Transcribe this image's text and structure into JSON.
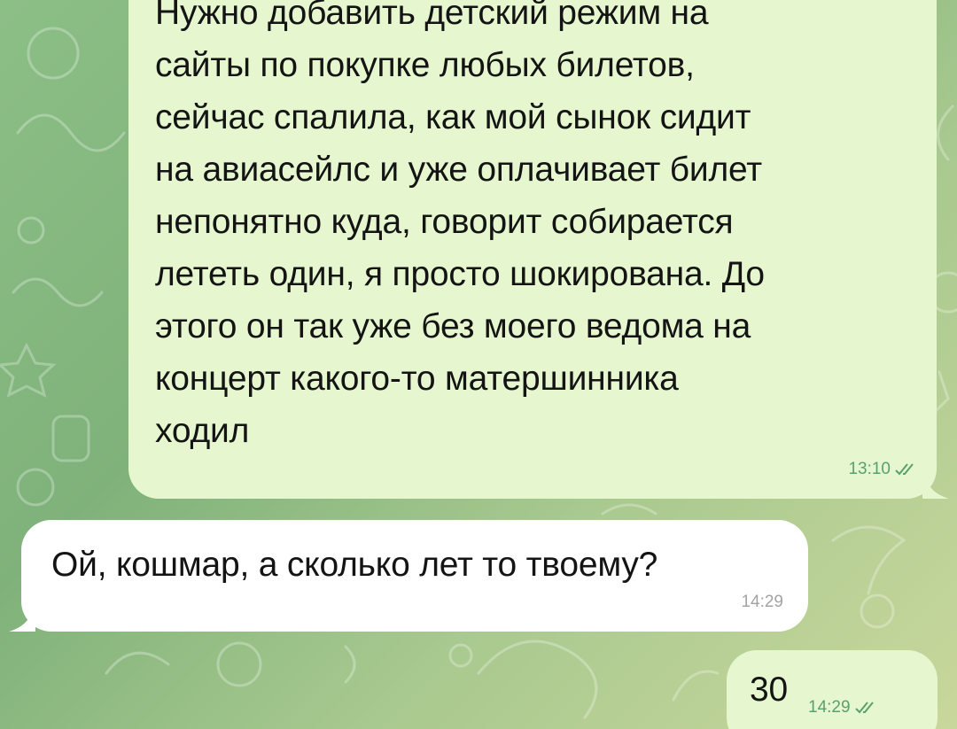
{
  "chat": {
    "messages": [
      {
        "direction": "outgoing",
        "text": "Нужно добавить детский режим на\nсайты по покупке любых билетов,\nсейчас спалила, как мой сынок сидит\nна авиасейлс и уже оплачивает билет\nнепонятно куда, говорит собирается\nлететь один, я просто шокирована. До\nэтого он так уже без моего ведома на\nконцерт какого-то матершинника\nходил",
        "time": "13:10",
        "status_icon": "double-check-icon"
      },
      {
        "direction": "incoming",
        "text": "Ой, кошмар, а сколько лет то твоему?",
        "time": "14:29"
      },
      {
        "direction": "outgoing",
        "text": "30",
        "time": "14:29",
        "status_icon": "double-check-icon"
      }
    ]
  },
  "colors": {
    "wallpaper_start": "#8cbf86",
    "wallpaper_end": "#c9d79c",
    "outgoing_bubble": "#e6f7cf",
    "incoming_bubble": "#ffffff",
    "outgoing_meta": "#5aa06a",
    "incoming_meta": "#a3a3a3"
  }
}
